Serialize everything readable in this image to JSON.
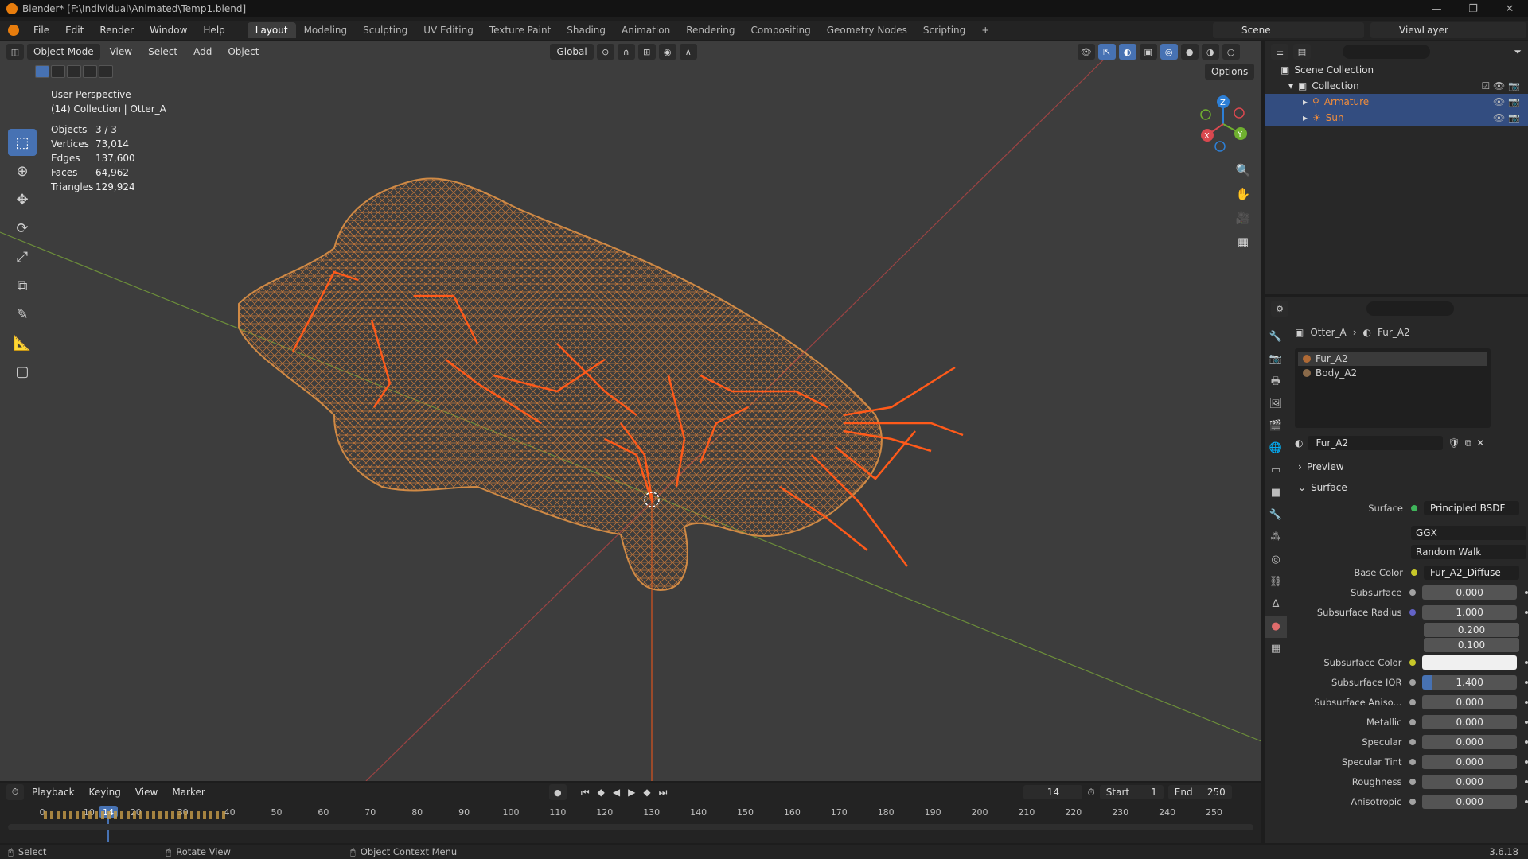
{
  "window": {
    "title": "Blender* [F:\\Individual\\Animated\\Temp1.blend]",
    "controls": [
      "—",
      "❐",
      "✕"
    ]
  },
  "menu": [
    "File",
    "Edit",
    "Render",
    "Window",
    "Help"
  ],
  "workspaces": [
    "Layout",
    "Modeling",
    "Sculpting",
    "UV Editing",
    "Texture Paint",
    "Shading",
    "Animation",
    "Rendering",
    "Compositing",
    "Geometry Nodes",
    "Scripting"
  ],
  "active_workspace": "Layout",
  "scene": "Scene",
  "view_layer": "ViewLayer",
  "viewport": {
    "mode": "Object Mode",
    "menus": [
      "View",
      "Select",
      "Add",
      "Object"
    ],
    "orientation": "Global",
    "options_label": "Options",
    "perspective": "User Perspective",
    "collection_info": "(14) Collection | Otter_A",
    "stats": [
      {
        "k": "Objects",
        "v": "3 / 3"
      },
      {
        "k": "Vertices",
        "v": "73,014"
      },
      {
        "k": "Edges",
        "v": "137,600"
      },
      {
        "k": "Faces",
        "v": "64,962"
      },
      {
        "k": "Triangles",
        "v": "129,924"
      }
    ],
    "gizmo_axes": [
      "X",
      "Y",
      "Z"
    ]
  },
  "outliner": {
    "root": "Scene Collection",
    "collection": "Collection",
    "items": [
      {
        "name": "Armature",
        "color": "#ef8c3b"
      },
      {
        "name": "Sun",
        "color": "#ef8c3b"
      }
    ]
  },
  "properties": {
    "breadcrumb": [
      "Otter_A",
      "Fur_A2"
    ],
    "materials": [
      "Fur_A2",
      "Body_A2"
    ],
    "material_name": "Fur_A2",
    "panels": {
      "preview": "Preview",
      "surface": "Surface"
    },
    "surface_shader": "Principled BSDF",
    "distribution": "GGX",
    "subsurface_method": "Random Walk",
    "base_color_label": "Base Color",
    "base_color_value": "Fur_A2_Diffuse",
    "rows": [
      {
        "label": "Subsurface",
        "value": "0.000"
      },
      {
        "label": "Subsurface Radius",
        "value": "1.000"
      },
      {
        "label": "",
        "value": "0.200"
      },
      {
        "label": "",
        "value": "0.100"
      },
      {
        "label": "Subsurface Color",
        "value": ""
      },
      {
        "label": "Subsurface IOR",
        "value": "1.400"
      },
      {
        "label": "Subsurface Aniso...",
        "value": "0.000"
      },
      {
        "label": "Metallic",
        "value": "0.000"
      },
      {
        "label": "Specular",
        "value": "0.000"
      },
      {
        "label": "Specular Tint",
        "value": "0.000"
      },
      {
        "label": "Roughness",
        "value": "0.000"
      },
      {
        "label": "Anisotropic",
        "value": "0.000"
      }
    ]
  },
  "timeline": {
    "menus": [
      "Playback",
      "Keying",
      "View",
      "Marker"
    ],
    "current_frame": "14",
    "start_label": "Start",
    "start": "1",
    "end_label": "End",
    "end": "250",
    "ticks": [
      "0",
      "10",
      "20",
      "30",
      "40",
      "50",
      "60",
      "70",
      "80",
      "90",
      "100",
      "110",
      "120",
      "130",
      "140",
      "150",
      "160",
      "170",
      "180",
      "190",
      "200",
      "210",
      "220",
      "230",
      "240",
      "250"
    ]
  },
  "statusbar": {
    "select": "Select",
    "rotate": "Rotate View",
    "context": "Object Context Menu",
    "version": "3.6.18"
  }
}
